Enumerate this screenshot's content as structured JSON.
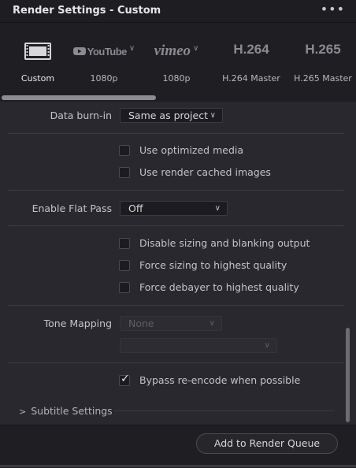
{
  "window": {
    "title": "Render Settings - Custom",
    "menu_icon": "more-horizontal-icon"
  },
  "presets": [
    {
      "logo": "film-icon",
      "label": "Custom"
    },
    {
      "logo": "YouTube",
      "label": "1080p"
    },
    {
      "logo": "vimeo",
      "label": "1080p"
    },
    {
      "logo": "H.264",
      "label": "H.264 Master"
    },
    {
      "logo": "H.265",
      "label": "H.265 Master"
    }
  ],
  "settings": {
    "data_burn_in": {
      "label": "Data burn-in",
      "value": "Same as project"
    },
    "use_optimized_media": {
      "label": "Use optimized media",
      "checked": false
    },
    "use_render_cached_images": {
      "label": "Use render cached images",
      "checked": false
    },
    "enable_flat_pass": {
      "label": "Enable Flat Pass",
      "value": "Off"
    },
    "disable_sizing": {
      "label": "Disable sizing and blanking output",
      "checked": false
    },
    "force_sizing": {
      "label": "Force sizing to highest quality",
      "checked": false
    },
    "force_debayer": {
      "label": "Force debayer to highest quality",
      "checked": false
    },
    "tone_mapping": {
      "label": "Tone Mapping",
      "value": "None",
      "secondary_value": ""
    },
    "bypass_reencode": {
      "label": "Bypass re-encode when possible",
      "checked": true
    },
    "subtitle_settings": {
      "label": "Subtitle Settings",
      "expanded": false
    }
  },
  "footer": {
    "add_button_label": "Add to Render Queue"
  },
  "colors": {
    "background": "#28282e",
    "panel": "#1f1f23",
    "text": "#c9c9cc"
  }
}
